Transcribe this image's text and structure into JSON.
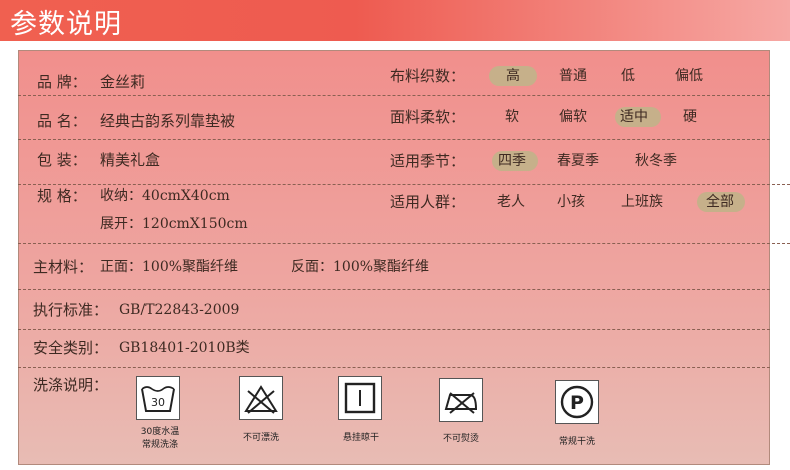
{
  "header": {
    "title": "参数说明"
  },
  "rows": {
    "brand": {
      "label": "品 牌：",
      "value": "金丝莉"
    },
    "name": {
      "label": "品 名：",
      "value": "经典古韵系列靠垫被"
    },
    "package": {
      "label": "包 装：",
      "value": "精美礼盒"
    },
    "spec": {
      "label": "规 格：",
      "folded": "收纳：40cmX40cm",
      "unfolded": "展开：120cmX150cm"
    },
    "material": {
      "label": "主材料：",
      "front": "正面：100%聚酯纤维",
      "back": "反面：100%聚酯纤维"
    },
    "standard": {
      "label": "执行标准：",
      "value": "GB/T22843-2009"
    },
    "safety": {
      "label": "安全类别：",
      "value": "GB18401-2010B类"
    },
    "wash": {
      "label": "洗涤说明："
    }
  },
  "attributes": {
    "density": {
      "label": "布料织数：",
      "options": [
        "高",
        "普通",
        "低",
        "偏低"
      ],
      "selected": "高"
    },
    "softness": {
      "label": "面料柔软：",
      "options": [
        "软",
        "偏软",
        "适中",
        "硬"
      ],
      "selected": "适中"
    },
    "season": {
      "label": "适用季节：",
      "options": [
        "四季",
        "春夏季",
        "秋冬季"
      ],
      "selected": "四季"
    },
    "people": {
      "label": "适用人群：",
      "options": [
        "老人",
        "小孩",
        "上班族",
        "全部"
      ],
      "selected": "全部"
    }
  },
  "care": [
    {
      "icon": "wash-30-icon",
      "symbol": "30",
      "caption_1": "30度水温",
      "caption_2": "常规洗涤"
    },
    {
      "icon": "no-bleach-icon",
      "caption_1": "不可漂洗"
    },
    {
      "icon": "hang-dry-icon",
      "caption_1": "悬挂晾干"
    },
    {
      "icon": "no-iron-icon",
      "caption_1": "不可熨烫"
    },
    {
      "icon": "dry-clean-p-icon",
      "symbol": "P",
      "caption_1": "常规干洗"
    }
  ]
}
